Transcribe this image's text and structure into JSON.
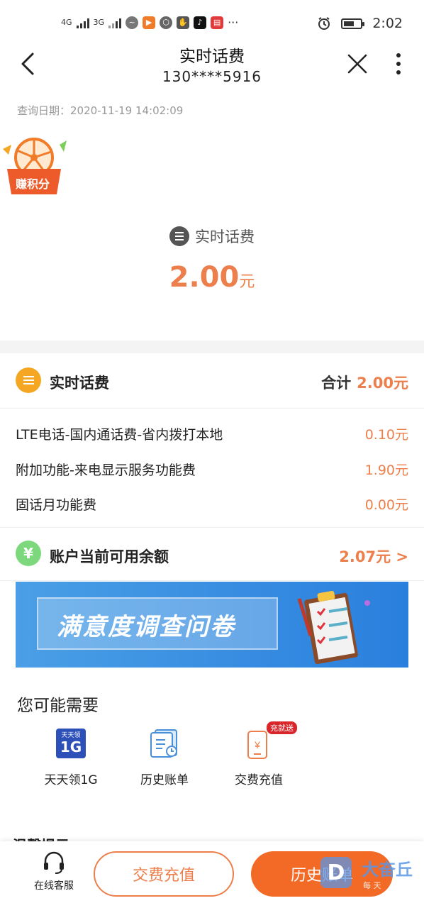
{
  "status_bar": {
    "network_1": "4G",
    "network_2": "3G",
    "more": "···",
    "time": "2:02"
  },
  "header": {
    "title": "实时话费",
    "phone": "130****5916"
  },
  "query_date": "查询日期：2020-11-19 14:02:09",
  "earn_points_badge": "赚积分",
  "summary": {
    "label": "实时话费",
    "amount": "2.00",
    "unit": "元"
  },
  "fee_section": {
    "title": "实时话费",
    "total_label": "合计",
    "total_value": "2.00元",
    "items": [
      {
        "name": "LTE电话-国内通话费-省内拨打本地",
        "value": "0.10元"
      },
      {
        "name": "附加功能-来电显示服务功能费",
        "value": "1.90元"
      },
      {
        "name": "固话月功能费",
        "value": "0.00元"
      }
    ]
  },
  "balance": {
    "title": "账户当前可用余额",
    "value": "2.07元 >"
  },
  "banner": {
    "text": "满意度调查问卷"
  },
  "may_need": {
    "title": "您可能需要",
    "services": [
      {
        "label": "天天领1G",
        "icon": "data-1g-icon",
        "icon_text": "1G",
        "icon_sub": "天天领"
      },
      {
        "label": "历史账单",
        "icon": "history-bill-icon"
      },
      {
        "label": "交费充值",
        "icon": "recharge-icon",
        "promo": "充就送"
      }
    ]
  },
  "tip_partial": "温馨提示：",
  "bottom_bar": {
    "customer_service": "在线客服",
    "recharge_button": "交费充值",
    "history_button": "历史账单"
  },
  "watermark": {
    "text": "大奋丘",
    "sub": "每 天"
  },
  "colors": {
    "accent": "#ec7f4b",
    "button_fill": "#f26a25",
    "banner": "#2a7fdd"
  }
}
